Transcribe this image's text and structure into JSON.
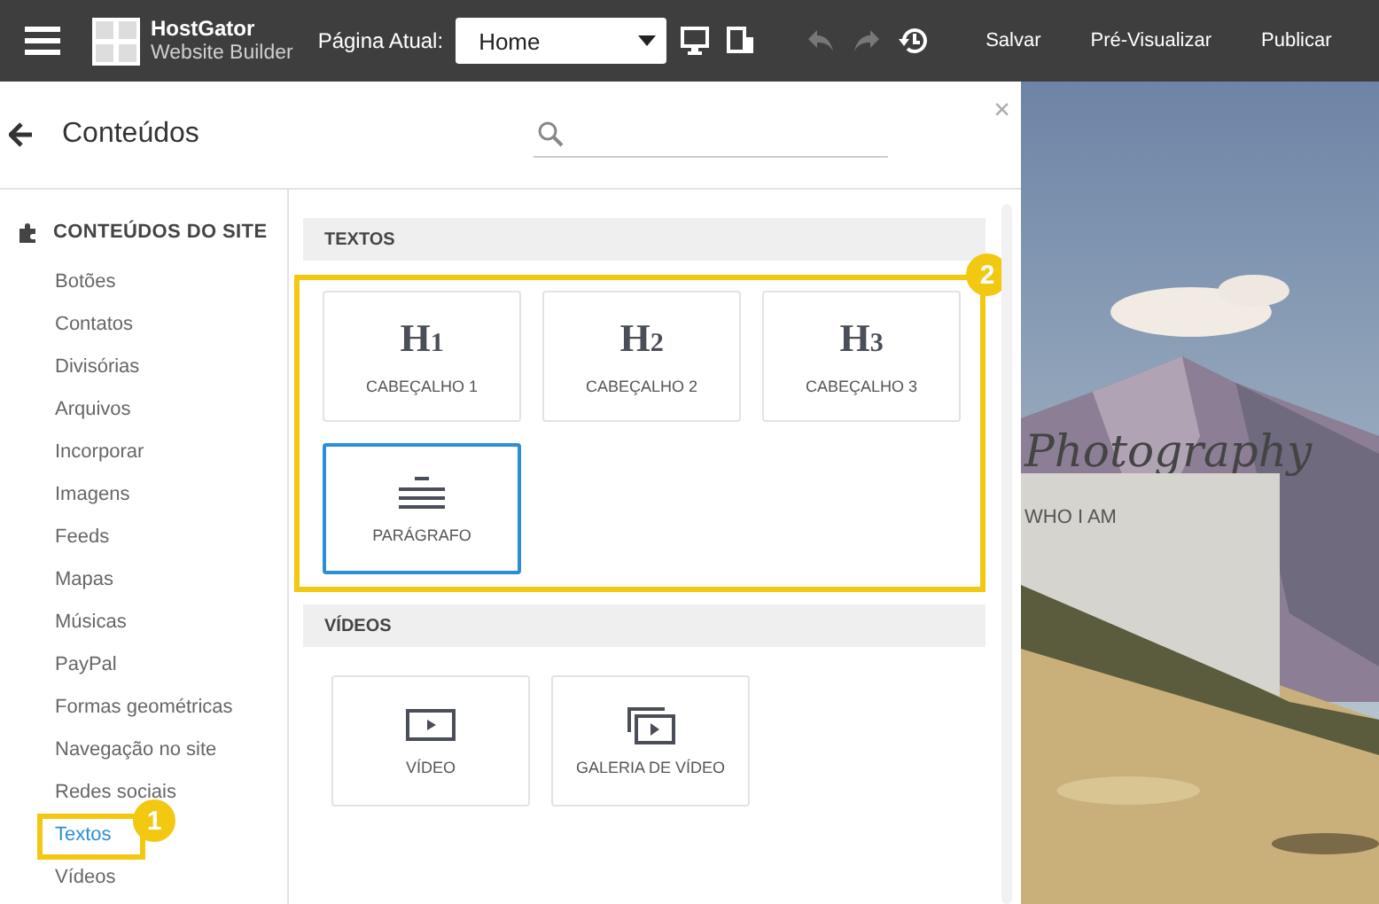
{
  "toolbar": {
    "brand_name": "HostGator",
    "brand_sub": "Website Builder",
    "page_label": "Página Atual:",
    "page_select": "Home",
    "undo_disabled": true,
    "redo_disabled": true,
    "actions": [
      "Salvar",
      "Pré-Visualizar",
      "Publicar"
    ]
  },
  "panel": {
    "title": "Conteúdos",
    "close": "×"
  },
  "sidebar": {
    "heading": "CONTEÚDOS DO SITE",
    "items": [
      {
        "label": "Botões",
        "selected": false
      },
      {
        "label": "Contatos",
        "selected": false
      },
      {
        "label": "Divisórias",
        "selected": false
      },
      {
        "label": "Arquivos",
        "selected": false
      },
      {
        "label": "Incorporar",
        "selected": false
      },
      {
        "label": "Imagens",
        "selected": false
      },
      {
        "label": "Feeds",
        "selected": false
      },
      {
        "label": "Mapas",
        "selected": false
      },
      {
        "label": "Músicas",
        "selected": false
      },
      {
        "label": "PayPal",
        "selected": false
      },
      {
        "label": "Formas geométricas",
        "selected": false
      },
      {
        "label": "Navegação no site",
        "selected": false
      },
      {
        "label": "Redes sociais",
        "selected": false
      },
      {
        "label": "Textos",
        "selected": true,
        "callout": "1"
      },
      {
        "label": "Vídeos",
        "selected": false
      }
    ]
  },
  "sections": [
    {
      "title": "TEXTOS",
      "callout": "2",
      "tiles": [
        {
          "kind": "heading",
          "icon_text": "H$_{1}$",
          "label": "CABEÇALHO 1",
          "selected": false
        },
        {
          "kind": "heading",
          "icon_text": "H$_{2}$",
          "label": "CABEÇALHO 2",
          "selected": false
        },
        {
          "kind": "heading",
          "icon_text": "H$_{3}$",
          "label": "CABEÇALHO 3",
          "selected": false
        },
        {
          "kind": "paragraph",
          "label": "PARÁGRAFO",
          "selected": true
        }
      ]
    },
    {
      "title": "VÍDEOS",
      "tiles": [
        {
          "kind": "video",
          "label": "VÍDEO",
          "selected": false
        },
        {
          "kind": "gallery",
          "label": "GALERIA DE VÍDEO",
          "selected": false
        }
      ]
    }
  ],
  "preview": {
    "title": "Photography",
    "box_text": "WHO I AM"
  }
}
